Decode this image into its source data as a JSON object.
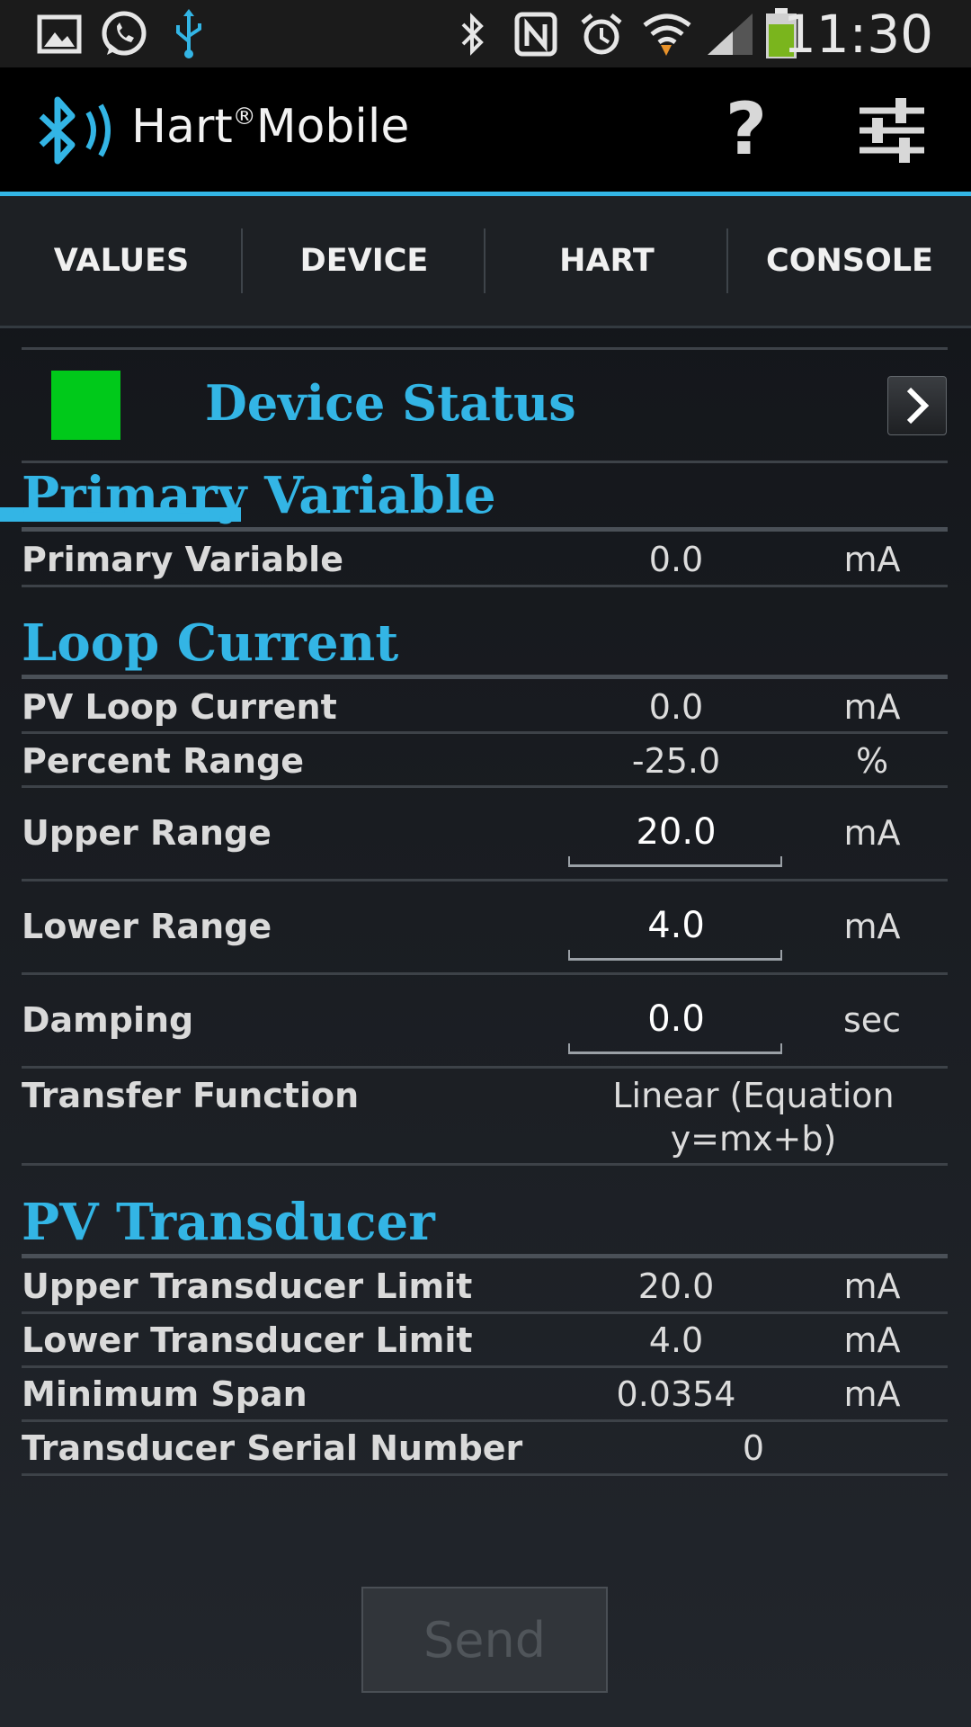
{
  "status_bar": {
    "time": "11:30",
    "left_icons": [
      "gallery-icon",
      "whatsapp-icon",
      "usb-icon"
    ],
    "right_icons": [
      "bluetooth-icon",
      "nfc-icon",
      "alarm-icon",
      "wifi-icon",
      "signal-icon",
      "battery-icon"
    ]
  },
  "app": {
    "title_pre": "Hart",
    "title_reg": "®",
    "title_post": "Mobile",
    "accent": "#33b5e5"
  },
  "tabs": [
    {
      "label": "VALUES",
      "selected": true
    },
    {
      "label": "DEVICE",
      "selected": false
    },
    {
      "label": "HART",
      "selected": false
    },
    {
      "label": "CONSOLE",
      "selected": false
    }
  ],
  "device_status": {
    "title": "Device Status",
    "indicator_color": "#00c91a"
  },
  "primary_variable": {
    "heading": "Primary Variable",
    "rows": [
      {
        "label": "Primary Variable",
        "value": "0.0",
        "unit": "mA"
      }
    ]
  },
  "loop_current": {
    "heading": "Loop Current",
    "pv_loop_current": {
      "label": "PV Loop Current",
      "value": "0.0",
      "unit": "mA"
    },
    "percent_range": {
      "label": "Percent Range",
      "value": "-25.0",
      "unit": "%"
    },
    "upper_range": {
      "label": "Upper Range",
      "value": "20.0",
      "unit": "mA"
    },
    "lower_range": {
      "label": "Lower Range",
      "value": "4.0",
      "unit": "mA"
    },
    "damping": {
      "label": "Damping",
      "value": "0.0",
      "unit": "sec"
    },
    "transfer_function": {
      "label": "Transfer Function",
      "value_line1": "Linear (Equation",
      "value_line2": "y=mx+b)"
    }
  },
  "pv_transducer": {
    "heading": "PV Transducer",
    "upper_limit": {
      "label": "Upper Transducer Limit",
      "value": "20.0",
      "unit": "mA"
    },
    "lower_limit": {
      "label": "Lower Transducer Limit",
      "value": "4.0",
      "unit": "mA"
    },
    "min_span": {
      "label": "Minimum Span",
      "value": "0.0354",
      "unit": "mA"
    },
    "serial": {
      "label": "Transducer Serial Number",
      "value": "0"
    }
  },
  "send_button": {
    "label": "Send"
  }
}
